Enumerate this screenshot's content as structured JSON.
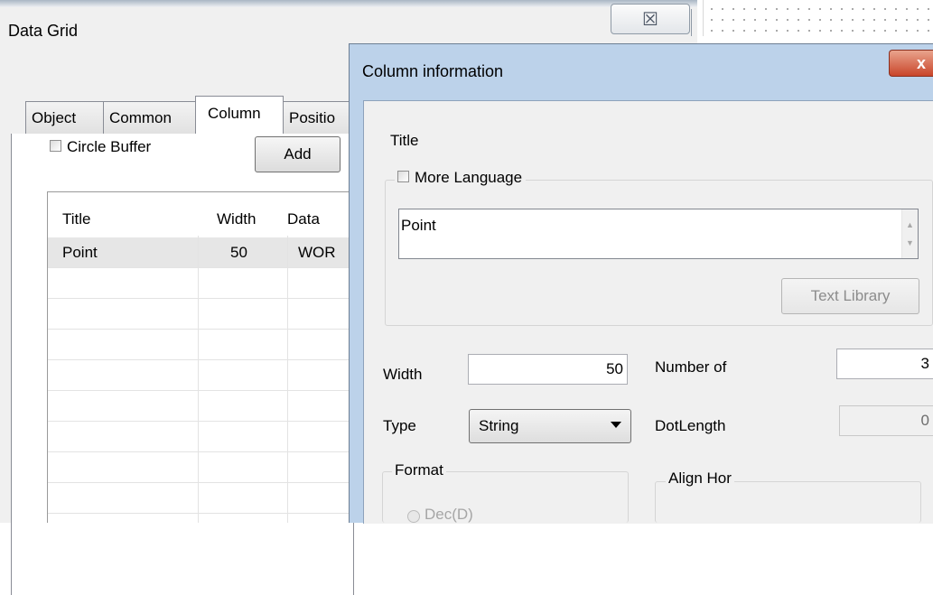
{
  "data_grid_window": {
    "title": "Data Grid",
    "close_glyph": "☒",
    "tabs": [
      {
        "label": "Object"
      },
      {
        "label": "Common"
      },
      {
        "label": "Column"
      },
      {
        "label": "Positio"
      }
    ],
    "circle_buffer_label": "Circle Buffer",
    "add_button_label": "Add",
    "grid": {
      "headers": [
        "Title",
        "Width",
        "Data"
      ],
      "rows": [
        {
          "title": "Point",
          "width": "50",
          "data": "WOR"
        }
      ]
    }
  },
  "column_info_dialog": {
    "title": "Column information",
    "close_glyph": "x",
    "title_label": "Title",
    "more_language_label": "More Language",
    "title_text_value": "Point",
    "text_library_button_label": "Text Library",
    "width_label": "Width",
    "width_value": "50",
    "number_of_label": "Number of",
    "number_of_value": "3",
    "type_label": "Type",
    "type_value": "String",
    "dot_length_label": "DotLength",
    "dot_length_value": "0",
    "format_label": "Format",
    "format_option_label": "Dec(D)",
    "align_hor_label": "Align Hor"
  }
}
